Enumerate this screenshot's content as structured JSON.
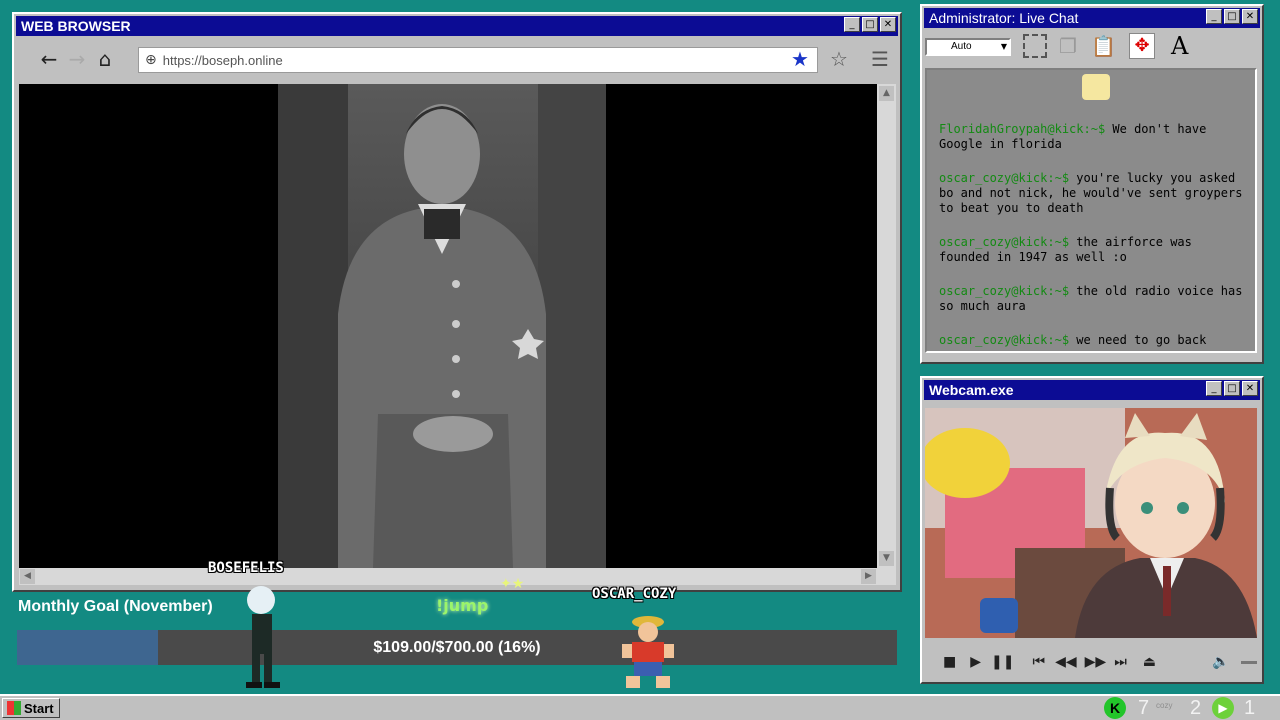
{
  "browser": {
    "title": "WEB BROWSER",
    "url": "https://boseph.online"
  },
  "chat": {
    "title": "Administrator: Live Chat",
    "font_size_select": "Auto",
    "messages": [
      {
        "user": "FloridahGroypah@kick:~$",
        "text": " We don't have Google in florida"
      },
      {
        "user": "oscar_cozy@kick:~$",
        "text": " you're lucky you asked bo and not nick, he would've sent groypers to beat you to death"
      },
      {
        "user": "oscar_cozy@kick:~$",
        "text": " the airforce was founded in 1947 as well :o"
      },
      {
        "user": "oscar_cozy@kick:~$",
        "text": " the old radio voice has so much aura"
      },
      {
        "user": "oscar_cozy@kick:~$",
        "text": " we need to go back"
      }
    ]
  },
  "webcam": {
    "title": "Webcam.exe"
  },
  "goal": {
    "title": "Monthly Goal (November)",
    "amount_text": "$109.00/$700.00 (16%)",
    "progress": 0.16
  },
  "overlay": {
    "name1": "BOSEFELIS",
    "name2": "OSCAR_COZY",
    "jump_text": "!jump"
  },
  "taskbar": {
    "start_label": "Start",
    "count_kick": "7",
    "count_small_label": "cozy",
    "count_2": "2",
    "count_3": "1"
  },
  "colors": {
    "desktop": "#138a82",
    "titlebar": "#0c0c94",
    "chat_user": "#138a13",
    "goal_fill": "#3e6690"
  }
}
